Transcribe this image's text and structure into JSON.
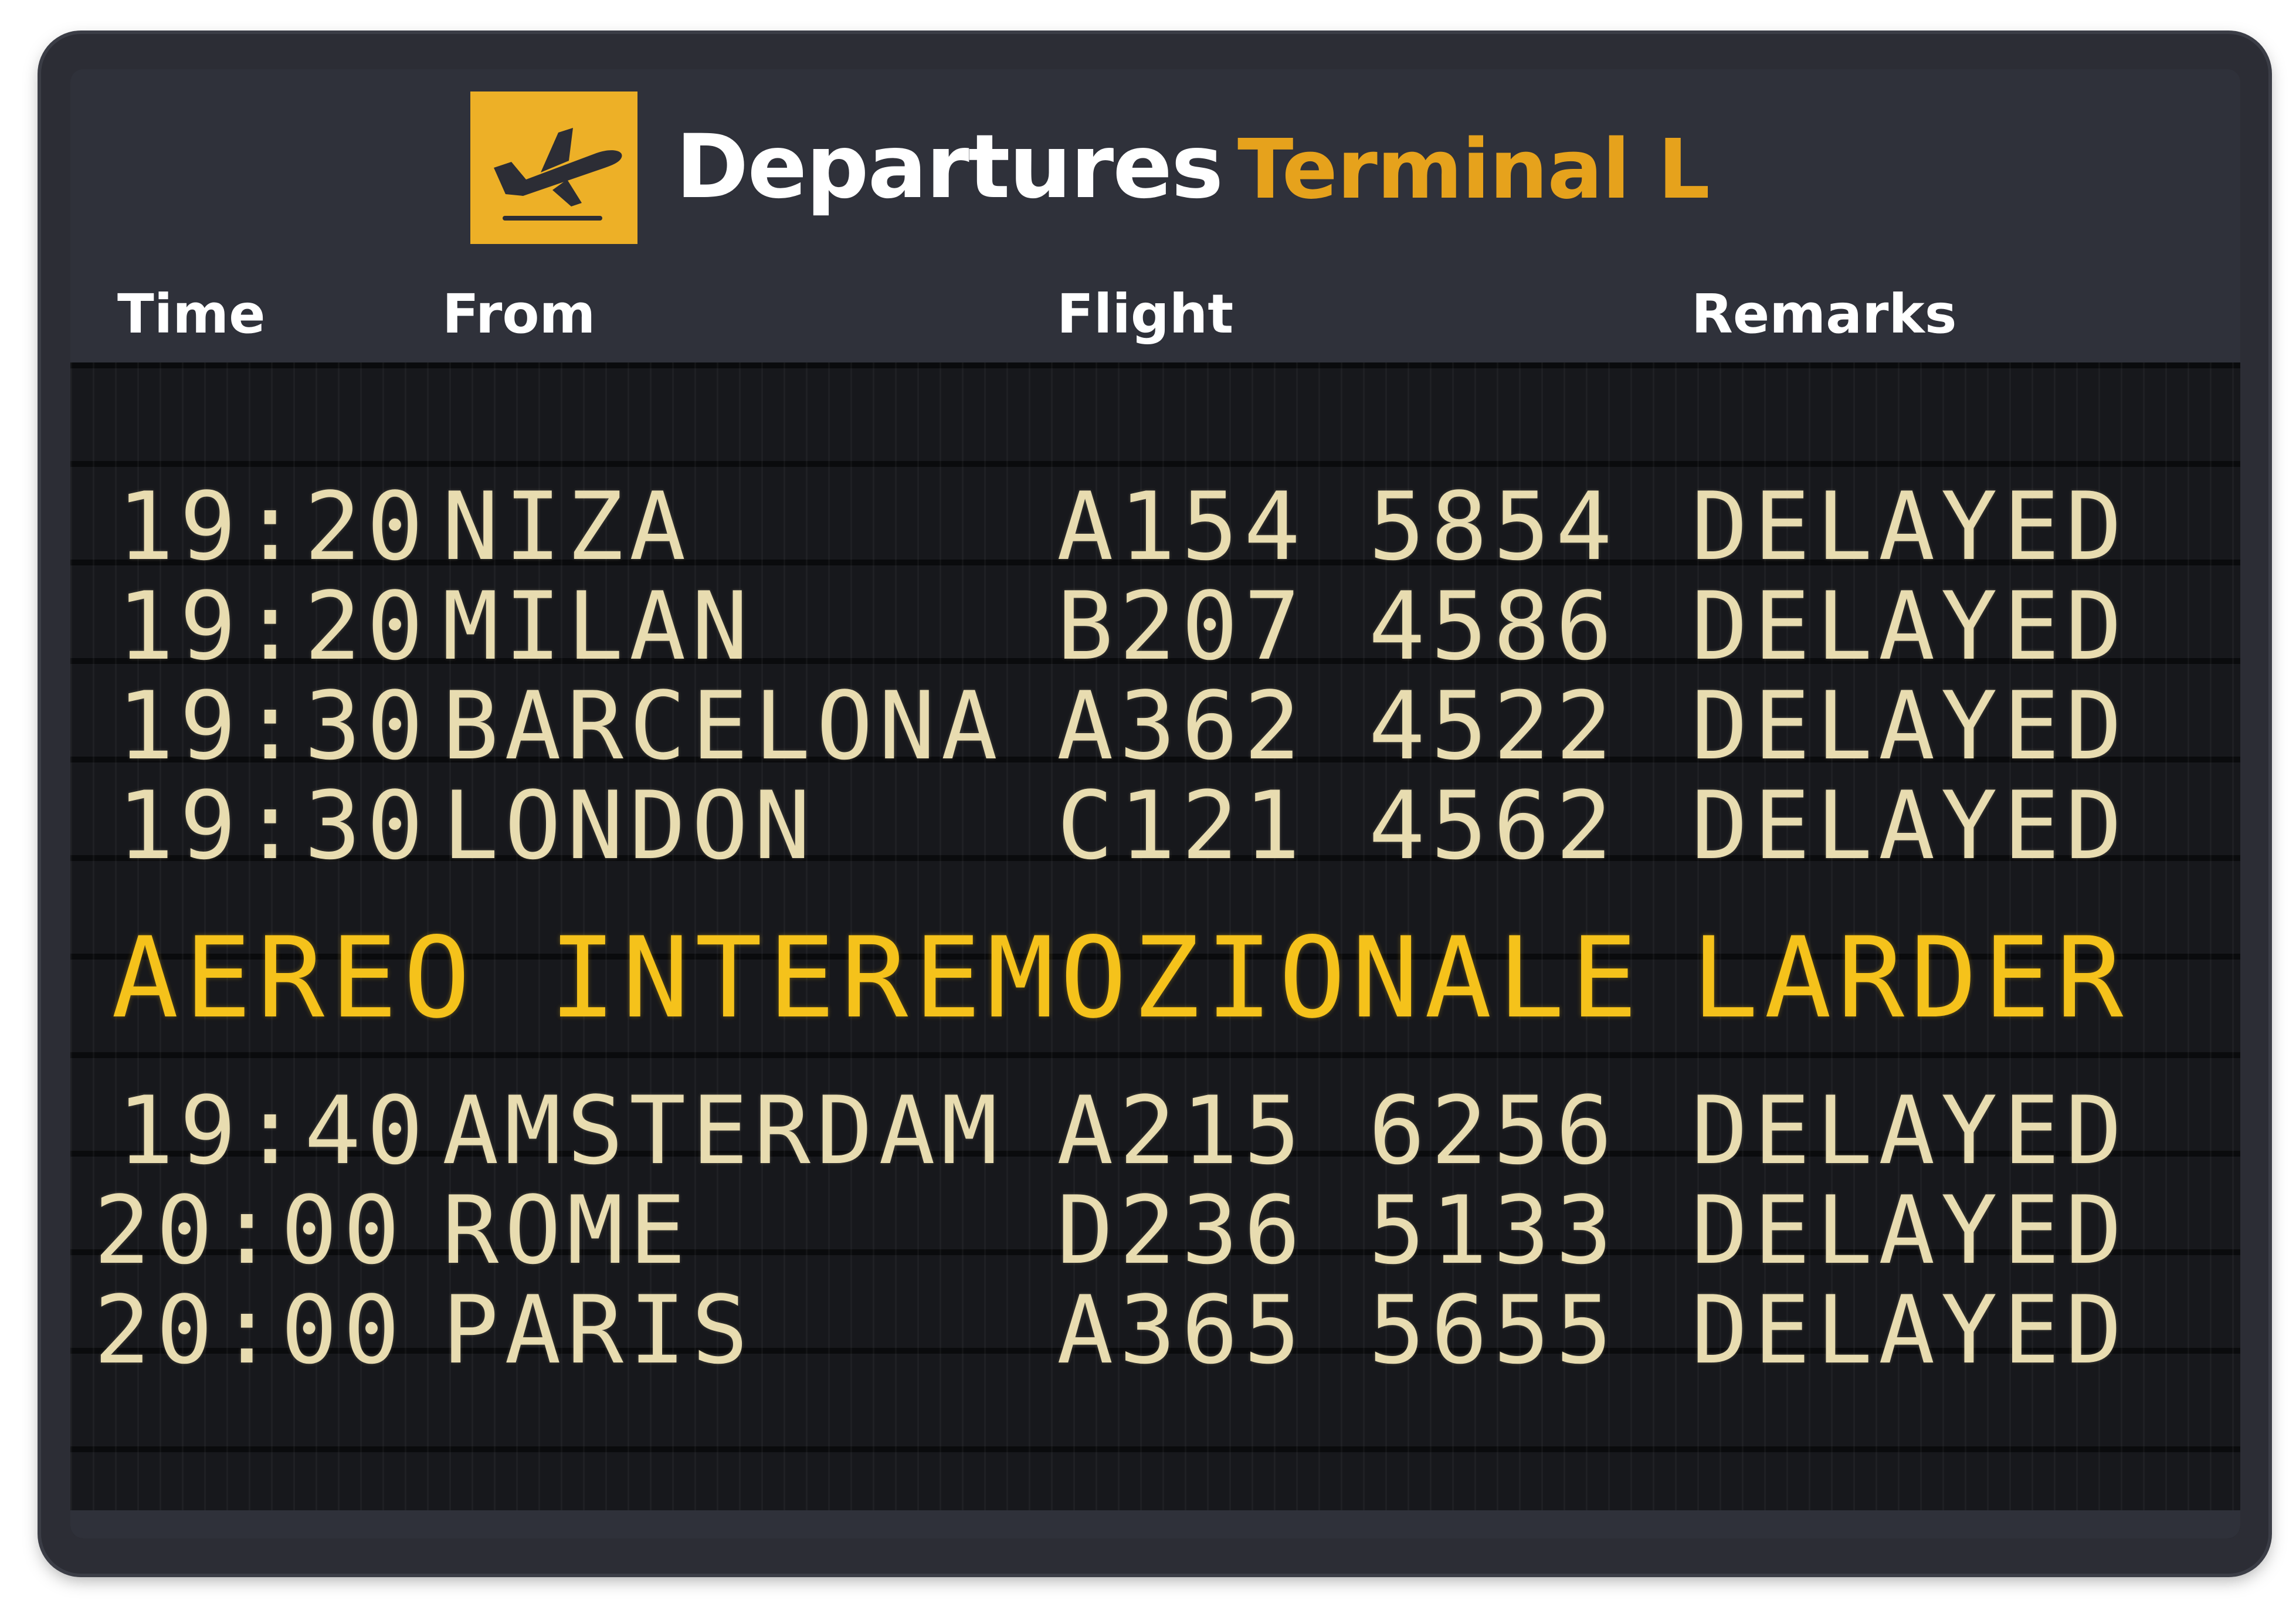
{
  "header": {
    "title": "Departures",
    "subtitle": "Terminal L",
    "icon": "airplane-takeoff-icon"
  },
  "columns": {
    "time": "Time",
    "from": "From",
    "flight": "Flight",
    "remarks": "Remarks"
  },
  "flights": [
    {
      "time": "19:20",
      "from": "NIZA",
      "flight": "A154 5854",
      "remarks": "DELAYED"
    },
    {
      "time": "19:20",
      "from": "MILAN",
      "flight": "B207 4586",
      "remarks": "DELAYED"
    },
    {
      "time": "19:30",
      "from": "BARCELONA",
      "flight": "A362 4522",
      "remarks": "DELAYED"
    },
    {
      "time": "19:30",
      "from": "LONDON",
      "flight": "C121 4562",
      "remarks": "DELAYED"
    }
  ],
  "notice": {
    "text": "AEREO INTEREMOZIONALE",
    "remarks": "LARDER"
  },
  "flights_after": [
    {
      "time": "19:40",
      "from": "AMSTERDAM",
      "flight": "A215 6256",
      "remarks": "DELAYED"
    },
    {
      "time": "20:00",
      "from": "ROME",
      "flight": "D236 5133",
      "remarks": "DELAYED"
    },
    {
      "time": "20:00",
      "from": "PARIS",
      "flight": "A365 5655",
      "remarks": "DELAYED"
    }
  ],
  "colors": {
    "board": "#2c2d35",
    "display": "#17181c",
    "accent": "#edb027",
    "terminal_text": "#e6a21c",
    "digit_text": "#e8dcb0",
    "notice_text": "#f5c21b"
  }
}
